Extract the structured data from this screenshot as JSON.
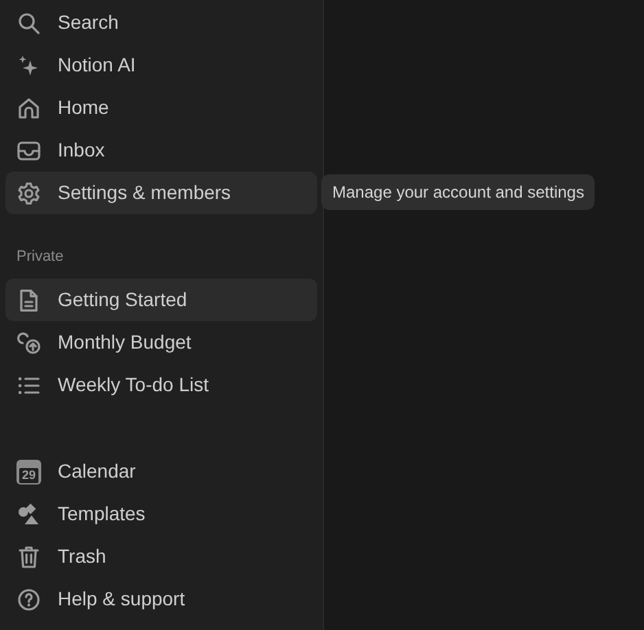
{
  "sidebar": {
    "top_items": [
      {
        "label": "Search",
        "hovered": false
      },
      {
        "label": "Notion AI",
        "hovered": false
      },
      {
        "label": "Home",
        "hovered": false
      },
      {
        "label": "Inbox",
        "hovered": false
      },
      {
        "label": "Settings & members",
        "hovered": true
      }
    ],
    "private": {
      "heading": "Private",
      "pages": [
        {
          "label": "Getting Started",
          "selected": true
        },
        {
          "label": "Monthly Budget",
          "selected": false
        },
        {
          "label": "Weekly To-do List",
          "selected": false
        }
      ]
    },
    "bottom_items": [
      {
        "label": "Calendar",
        "icon_text": "29"
      },
      {
        "label": "Templates"
      },
      {
        "label": "Trash"
      },
      {
        "label": "Help & support"
      }
    ]
  },
  "tooltip": {
    "text": "Manage your account and settings"
  }
}
